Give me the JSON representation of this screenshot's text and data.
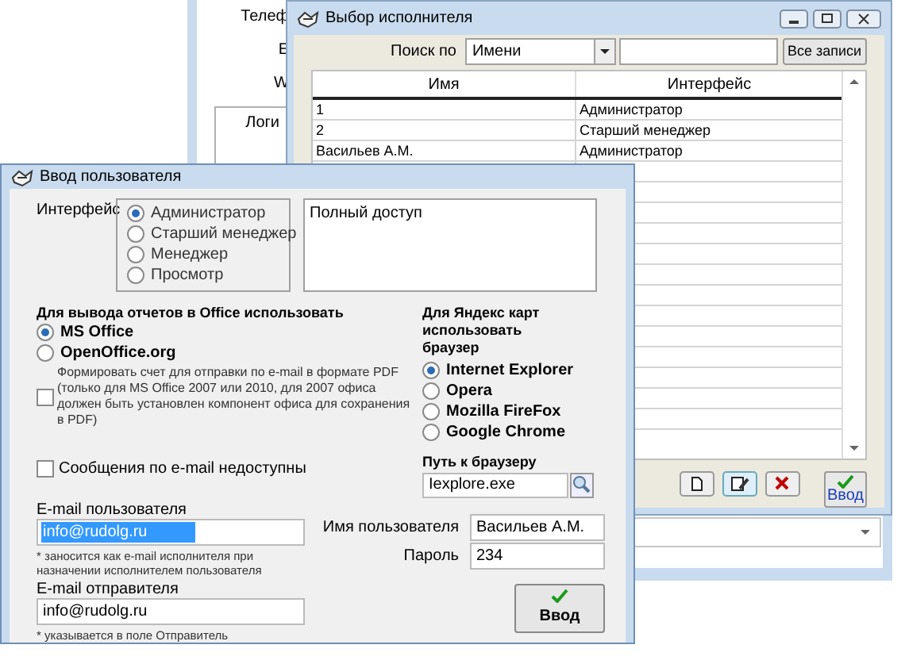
{
  "background_window": {
    "labels": [
      "Телеф",
      "Е",
      "W",
      "Логи"
    ]
  },
  "selection_window": {
    "title": "Выбор исполнителя",
    "search_label": "Поиск по",
    "search_by": "Имени",
    "all_records_button": "Все записи",
    "table": {
      "columns": [
        "Имя",
        "Интерфейс"
      ],
      "rows": [
        [
          "1",
          "Администратор"
        ],
        [
          "2",
          "Старший менеджер"
        ],
        [
          "Васильев А.М.",
          "Администратор"
        ]
      ]
    },
    "enter_button": "Ввод"
  },
  "user_dialog": {
    "title": "Ввод пользователя",
    "interface_label": "Интерфейс",
    "interface_options": [
      {
        "label": "Администратор",
        "selected": true
      },
      {
        "label": "Старший менеджер",
        "selected": false
      },
      {
        "label": "Менеджер",
        "selected": false
      },
      {
        "label": "Просмотр",
        "selected": false
      }
    ],
    "access_description": "Полный доступ",
    "office_heading": "Для вывода отчетов в Office использовать",
    "office_options": [
      {
        "label": "MS Office",
        "selected": true
      },
      {
        "label": "OpenOffice.org",
        "selected": false
      }
    ],
    "pdf_option": {
      "label": "Формировать счет для отправки по e-mail в формате PDF (только для MS Office 2007 или 2010, для 2007 офиса должен быть установлен компонент офиса для  сохранения в PDF)",
      "checked": false
    },
    "email_disabled_option": {
      "label": "Сообщения по e-mail недоступны",
      "checked": false
    },
    "user_email": {
      "label": "E-mail пользователя",
      "value": "info@rudolg.ru",
      "text_selected": true,
      "note": "* заносится как e-mail исполнителя при назначении исполнителем пользователя"
    },
    "sender_email": {
      "label": "E-mail отправителя",
      "value": "info@rudolg.ru",
      "text_selected": false,
      "note": "* указывается в поле Отправитель"
    },
    "browser_heading": "Для Яндекс карт использовать браузер",
    "browser_options": [
      {
        "label": "Internet Explorer",
        "selected": true
      },
      {
        "label": "Opera",
        "selected": false
      },
      {
        "label": "Mozilla FireFox",
        "selected": false
      },
      {
        "label": "Google Chrome",
        "selected": false
      }
    ],
    "browser_path": {
      "label": "Путь к браузеру",
      "value": "Iexplore.exe"
    },
    "user_name": {
      "label": "Имя пользователя",
      "value": "Васильев А.М."
    },
    "password": {
      "label": "Пароль",
      "value": "234"
    },
    "enter_button": "Ввод"
  }
}
